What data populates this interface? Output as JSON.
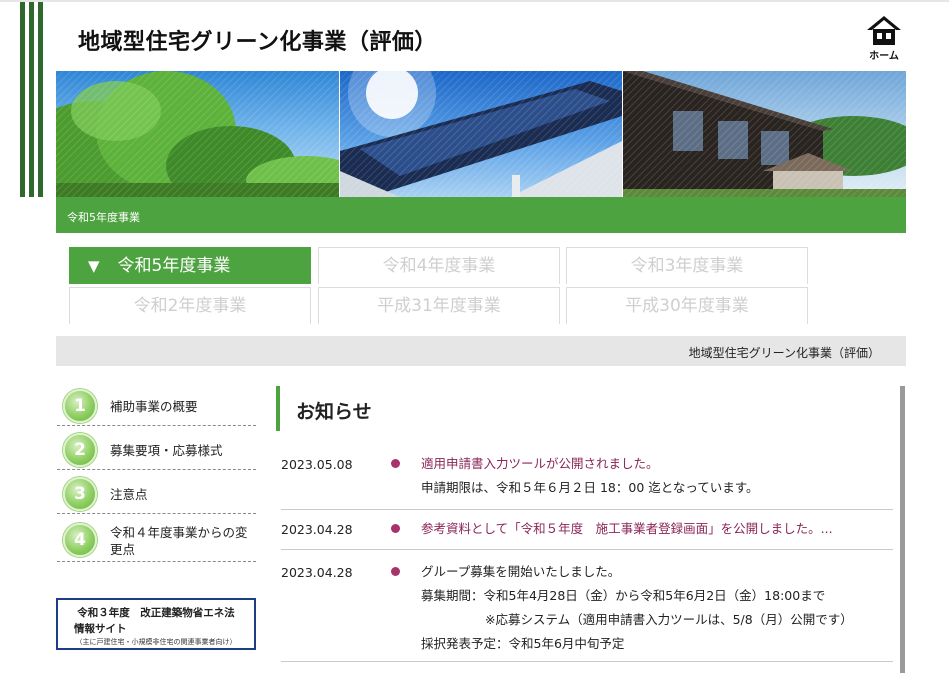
{
  "header": {
    "title": "地域型住宅グリーン化事業（評価）",
    "home_label": "ホーム"
  },
  "banner": {
    "caption": "令和5年度事業"
  },
  "tabs": [
    {
      "label": "令和5年度事業",
      "active": true,
      "marker": "▼"
    },
    {
      "label": "令和4年度事業",
      "active": false
    },
    {
      "label": "令和3年度事業",
      "active": false
    },
    {
      "label": "令和2年度事業",
      "active": false
    },
    {
      "label": "平成31年度事業",
      "active": false
    },
    {
      "label": "平成30年度事業",
      "active": false
    }
  ],
  "breadcrumb": "地域型住宅グリーン化事業（評価）",
  "sidebar": {
    "items": [
      {
        "num": "1",
        "label": "補助事業の概要"
      },
      {
        "num": "2",
        "label": "募集要項・応募様式"
      },
      {
        "num": "3",
        "label": "注意点"
      },
      {
        "num": "4",
        "label": "令和４年度事業からの変更点"
      }
    ],
    "banner": {
      "line1": "令和３年度　改正建築物省エネ法",
      "line2": "情報サイト",
      "line3": "（主に戸建住宅・小規模非住宅の関連事業者向け）"
    }
  },
  "news": {
    "heading": "お知らせ",
    "items": [
      {
        "date": "2023.05.08",
        "link": "適用申請書入力ツールが公開されました。",
        "lines": [
          "申請期限は、令和５年６月２日 18：00 迄となっています。"
        ]
      },
      {
        "date": "2023.04.28",
        "link": "参考資料として「令和５年度　施工事業者登録画面」を公開しました。...",
        "lines": []
      },
      {
        "date": "2023.04.28",
        "text": "グループ募集を開始いたしました。",
        "lines": [
          "募集期間：令和5年4月28日（金）から令和5年6月2日（金）18:00まで",
          "※応募システム（適用申請書入力ツールは、5/8（月）公開です）",
          "採択発表予定：令和5年6月中旬予定"
        ]
      }
    ]
  },
  "colors": {
    "brand_green": "#4da33f",
    "dark_green": "#2f6a2c",
    "link": "#8a2557",
    "bullet": "#a8326a"
  }
}
